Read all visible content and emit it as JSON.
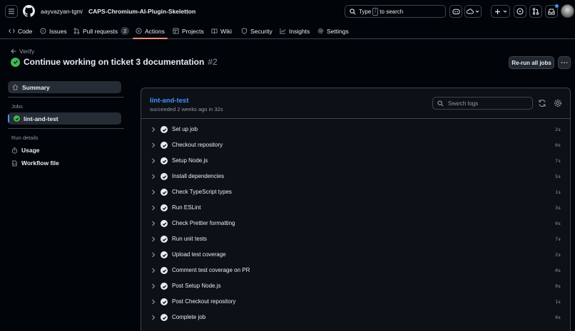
{
  "header": {
    "owner": "aayvazyan-tgm",
    "separator": "/",
    "repo": "CAPS-Chromium-AI-Plugin-Skeletton",
    "search_prefix": "Type",
    "search_key": "/",
    "search_suffix": "to search"
  },
  "nav": {
    "tabs": [
      {
        "label": "Code",
        "icon": "code-icon"
      },
      {
        "label": "Issues",
        "icon": "issue-icon"
      },
      {
        "label": "Pull requests",
        "icon": "pull-request-icon",
        "count": "2"
      },
      {
        "label": "Actions",
        "icon": "play-icon",
        "active": true
      },
      {
        "label": "Projects",
        "icon": "table-icon"
      },
      {
        "label": "Wiki",
        "icon": "book-icon"
      },
      {
        "label": "Security",
        "icon": "shield-icon"
      },
      {
        "label": "Insights",
        "icon": "graph-icon"
      },
      {
        "label": "Settings",
        "icon": "gear-icon"
      }
    ]
  },
  "run": {
    "back_label": "Verify",
    "title": "Continue working on ticket 3 documentation",
    "number": "#2",
    "rerun_label": "Re-run all jobs"
  },
  "sidebar": {
    "summary_label": "Summary",
    "jobs_heading": "Jobs",
    "job_label": "lint-and-test",
    "run_details_heading": "Run details",
    "usage_label": "Usage",
    "workflow_label": "Workflow file"
  },
  "job": {
    "name": "lint-and-test",
    "meta": "succeeded 2 weeks ago in 32s",
    "search_placeholder": "Search logs",
    "steps": [
      {
        "name": "Set up job",
        "duration": "2s"
      },
      {
        "name": "Checkout repository",
        "duration": "0s"
      },
      {
        "name": "Setup Node.js",
        "duration": "7s"
      },
      {
        "name": "Install dependencies",
        "duration": "5s"
      },
      {
        "name": "Check TypeScript types",
        "duration": "1s"
      },
      {
        "name": "Run ESLint",
        "duration": "3s"
      },
      {
        "name": "Check Prettier formatting",
        "duration": "0s"
      },
      {
        "name": "Run unit tests",
        "duration": "7s"
      },
      {
        "name": "Upload test coverage",
        "duration": "2s"
      },
      {
        "name": "Comment test coverage on PR",
        "duration": "0s"
      },
      {
        "name": "Post Setup Node.js",
        "duration": "0s"
      },
      {
        "name": "Post Checkout repository",
        "duration": "1s"
      },
      {
        "name": "Complete job",
        "duration": "0s"
      }
    ]
  },
  "colors": {
    "success": "#3fb950",
    "link": "#4493f8",
    "active_tab": "#fd8c73",
    "background": "#010409",
    "panel": "#0d1117"
  }
}
